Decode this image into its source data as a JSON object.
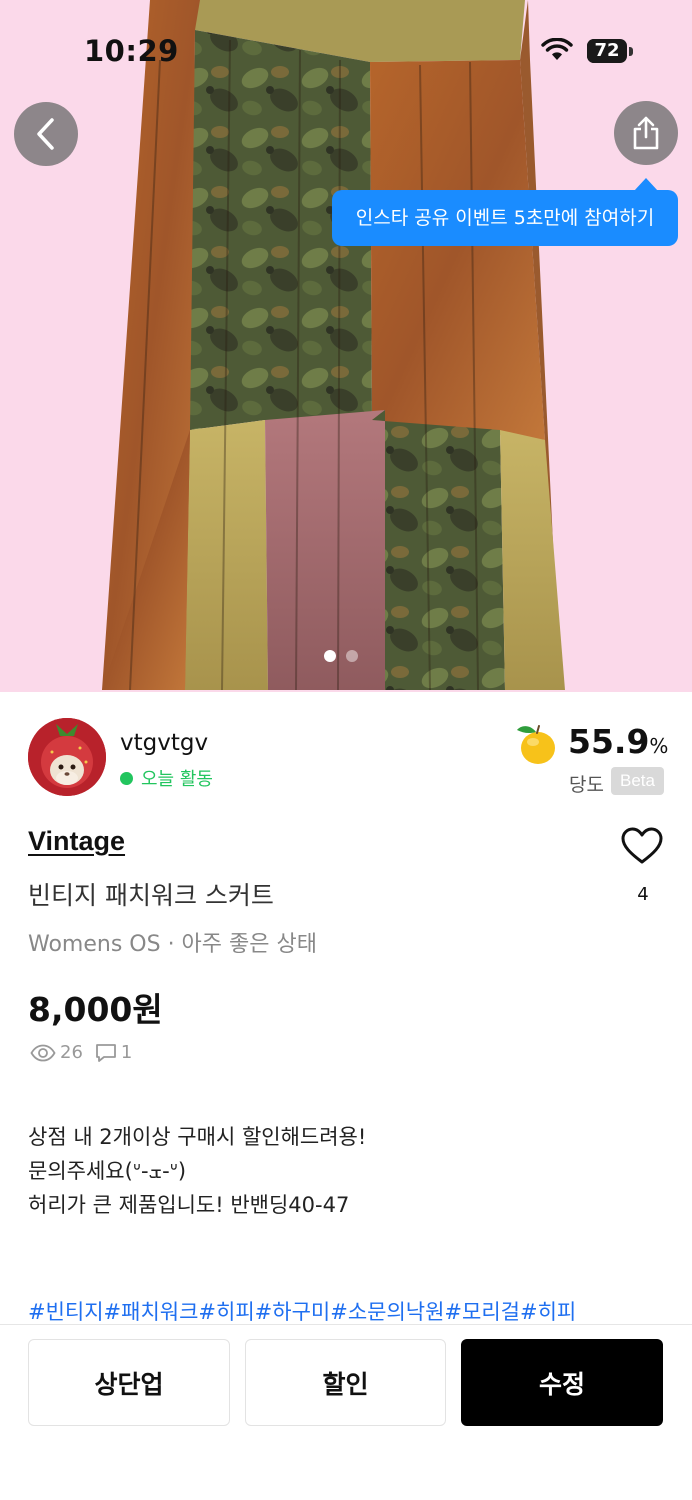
{
  "status_bar": {
    "time": "10:29",
    "battery": "72",
    "battery_level_percent": 72
  },
  "hero": {
    "share_tooltip": "인스타 공유 이벤트 5초만에 참여하기",
    "page_count": 2,
    "current_page": 1,
    "background_color": "#fbd9ea"
  },
  "seller": {
    "name": "vtgvtgv",
    "activity": "오늘 활동",
    "activity_color": "#22c55e",
    "sweetness_value": "55.9",
    "sweetness_unit": "%",
    "sweetness_label": "당도",
    "beta_label": "Beta"
  },
  "product": {
    "brand": "Vintage",
    "title": "빈티지 패치워크 스커트",
    "meta": "Womens OS · 아주 좋은 상태",
    "price": "8,000원",
    "likes": "4",
    "views": "26",
    "comments": "1",
    "description_lines": [
      "상점 내 2개이상 구매시 할인해드려용!",
      "문의주세요(ᐡ-ܫ-ᐡ)",
      "",
      "허리가 큰 제품입니도! 반밴딩40-47"
    ],
    "tags": "#빈티지#패치워크#히피#하구미#소문의낙원#모리걸#히피",
    "tag_color": "#1f6ff0"
  },
  "actions": {
    "bump_label": "상단업",
    "discount_label": "할인",
    "edit_label": "수정"
  },
  "icons": {
    "back": "chevron-left-icon",
    "share": "share-icon",
    "like": "heart-icon",
    "views": "eye-icon",
    "comments": "comment-icon",
    "sweetness": "fruit-icon"
  }
}
